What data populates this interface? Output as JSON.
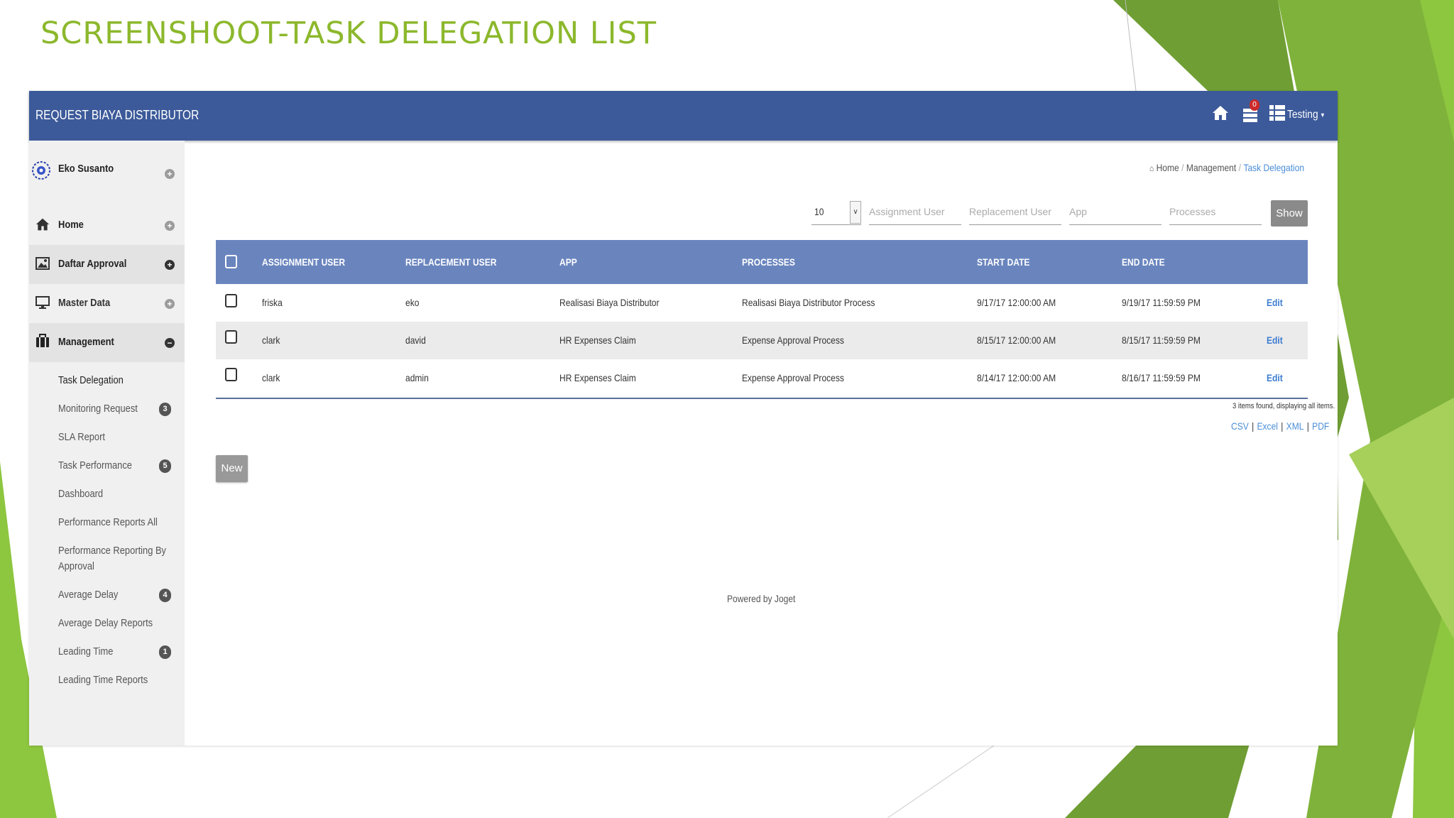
{
  "slide": {
    "title": "SCREENSHOOT-TASK DELEGATION LIST",
    "accent_color": "#8cb82c"
  },
  "navbar": {
    "app_title": "REQUEST BIAYA DISTRIBUTOR",
    "notification_count": "0",
    "user_menu_label": "Testing",
    "icons": [
      "home-icon",
      "task-list-icon",
      "apps-grid-icon",
      "caret-down-icon"
    ],
    "color": "#3c5a9a"
  },
  "sidebar": {
    "profile_name": "Eko Susanto",
    "menu": [
      {
        "label": "Home",
        "icon": "home-icon",
        "toggle": "+"
      },
      {
        "label": "Daftar Approval",
        "icon": "image-icon",
        "toggle": "+"
      },
      {
        "label": "Master Data",
        "icon": "monitor-icon",
        "toggle": "+"
      },
      {
        "label": "Management",
        "icon": "briefcase-icon",
        "toggle": "−"
      }
    ],
    "submenu": [
      {
        "label": "Task Delegation",
        "badge": ""
      },
      {
        "label": "Monitoring Request",
        "badge": "3"
      },
      {
        "label": "SLA Report",
        "badge": ""
      },
      {
        "label": "Task Performance",
        "badge": "5"
      },
      {
        "label": "Dashboard",
        "badge": ""
      },
      {
        "label": "Performance Reports All",
        "badge": ""
      },
      {
        "label": "Performance Reporting By",
        "label2": "Approval",
        "badge": ""
      },
      {
        "label": "Average Delay",
        "badge": "4"
      },
      {
        "label": "Average Delay Reports",
        "badge": ""
      },
      {
        "label": "Leading Time",
        "badge": "1"
      },
      {
        "label": "Leading Time Reports",
        "badge": ""
      }
    ]
  },
  "breadcrumb": {
    "home": "Home",
    "separator": "/",
    "level1": "Management",
    "current": "Task Delegation"
  },
  "filters": {
    "page_size": "10",
    "assignment_user_placeholder": "Assignment User",
    "replacement_user_placeholder": "Replacement User",
    "app_placeholder": "App",
    "processes_placeholder": "Processes",
    "show_label": "Show"
  },
  "table": {
    "headers": [
      "ASSIGNMENT USER",
      "REPLACEMENT USER",
      "APP",
      "PROCESSES",
      "START DATE",
      "END DATE"
    ],
    "rows": [
      {
        "assignment": "friska",
        "replacement": "eko",
        "app": "Realisasi Biaya Distributor",
        "process": "Realisasi Biaya Distributor Process",
        "start": "9/17/17 12:00:00 AM",
        "end": "9/19/17 11:59:59 PM",
        "action": "Edit"
      },
      {
        "assignment": "clark",
        "replacement": "david",
        "app": "HR Expenses Claim",
        "process": "Expense Approval Process",
        "start": "8/15/17 12:00:00 AM",
        "end": "8/15/17 11:59:59 PM",
        "action": "Edit"
      },
      {
        "assignment": "clark",
        "replacement": "admin",
        "app": "HR Expenses Claim",
        "process": "Expense Approval Process",
        "start": "8/14/17 12:00:00 AM",
        "end": "8/16/17 11:59:59 PM",
        "action": "Edit"
      }
    ],
    "items_found": "3 items found, displaying all items.",
    "header_color": "#6a85be"
  },
  "export": {
    "csv": "CSV",
    "excel": "Excel",
    "xml": "XML",
    "pdf": "PDF",
    "separator": "|"
  },
  "actions": {
    "new_label": "New"
  },
  "footer": {
    "powered_by": "Powered by Joget"
  }
}
